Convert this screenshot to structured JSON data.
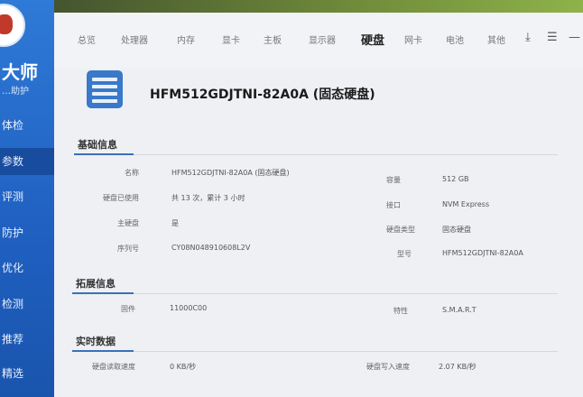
{
  "app": {
    "brand": "大师",
    "brand_sub": "…助护"
  },
  "sidebar": {
    "items": [
      {
        "label": "体检"
      },
      {
        "label": "参数"
      },
      {
        "label": "评测"
      },
      {
        "label": "防护"
      },
      {
        "label": "优化"
      },
      {
        "label": "检测"
      },
      {
        "label": "推荐"
      },
      {
        "label": "精选"
      }
    ]
  },
  "tabs": [
    "总览",
    "处理器",
    "内存",
    "显卡",
    "主板",
    "显示器",
    "硬盘",
    "网卡",
    "电池",
    "其他"
  ],
  "active_tab": "硬盘",
  "window_controls": {
    "download": "⤓",
    "menu": "☰",
    "minimize": "—"
  },
  "device": {
    "title": "HFM512GDJTNI-82A0A (固态硬盘)",
    "icon": "hard-disk-icon"
  },
  "sections": {
    "basic": "基础信息",
    "extended": "拓展信息",
    "realtime": "实时数据"
  },
  "basic_info": {
    "name_label": "名称",
    "name_value": "HFM512GDJTNI-82A0A (固态硬盘)",
    "capacity_label": "容量",
    "capacity_value": "512 GB",
    "used_label": "硬盘已使用",
    "used_value": "共 13 次，累计 3 小时",
    "interface_label": "接口",
    "interface_value": "NVM Express",
    "primary_label": "主硬盘",
    "primary_value": "是",
    "type_label": "硬盘类型",
    "type_value": "固态硬盘",
    "serial_label": "序列号",
    "serial_value": "CY08N048910608L2V",
    "model_label": "型号",
    "model_value": "HFM512GDJTNI-82A0A"
  },
  "extended_info": {
    "firmware_label": "固件",
    "firmware_value": "11000C00",
    "feature_label": "特性",
    "feature_value": "S.M.A.R.T"
  },
  "realtime": {
    "read_label": "硬盘读取速度",
    "read_value": "0 KB/秒",
    "write_label": "硬盘写入速度",
    "write_value": "2.07 KB/秒"
  },
  "colors": {
    "accent": "#2f7ad6",
    "sidebar_active": "#174c9e",
    "section_line": "#3d6fb8"
  }
}
